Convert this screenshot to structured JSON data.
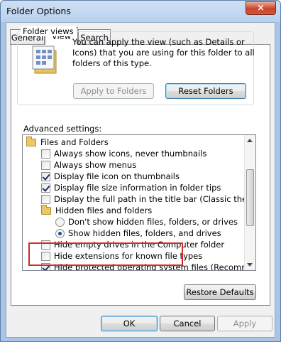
{
  "window": {
    "title": "Folder Options",
    "close_label": "×"
  },
  "tabs": [
    {
      "label": "General"
    },
    {
      "label": "View"
    },
    {
      "label": "Search"
    }
  ],
  "folder_views": {
    "legend": "Folder views",
    "description": "You can apply the view (such as Details or Icons) that you are using for this folder to all folders of this type.",
    "apply_button": "Apply to Folders",
    "reset_button": "Reset Folders"
  },
  "advanced": {
    "label": "Advanced settings:",
    "items": [
      {
        "type": "folder",
        "label": "Files and Folders"
      },
      {
        "type": "checkbox",
        "checked": false,
        "label": "Always show icons, never thumbnails"
      },
      {
        "type": "checkbox",
        "checked": false,
        "label": "Always show menus"
      },
      {
        "type": "checkbox",
        "checked": true,
        "label": "Display file icon on thumbnails"
      },
      {
        "type": "checkbox",
        "checked": true,
        "label": "Display file size information in folder tips"
      },
      {
        "type": "checkbox",
        "checked": false,
        "label": "Display the full path in the title bar (Classic theme only)"
      },
      {
        "type": "folder",
        "label": "Hidden files and folders"
      },
      {
        "type": "radio",
        "selected": false,
        "label": "Don't show hidden files, folders, or drives"
      },
      {
        "type": "radio",
        "selected": true,
        "label": "Show hidden files, folders, and drives"
      },
      {
        "type": "checkbox",
        "checked": false,
        "label": "Hide empty drives in the Computer folder"
      },
      {
        "type": "checkbox",
        "checked": false,
        "label": "Hide extensions for known file types"
      },
      {
        "type": "checkbox",
        "checked": true,
        "label": "Hide protected operating system files (Recommended)"
      }
    ],
    "restore_button": "Restore Defaults"
  },
  "footer": {
    "ok": "OK",
    "cancel": "Cancel",
    "apply": "Apply"
  },
  "colors": {
    "highlight_box": "#d42a2a",
    "accent": "#3c7fb1"
  }
}
